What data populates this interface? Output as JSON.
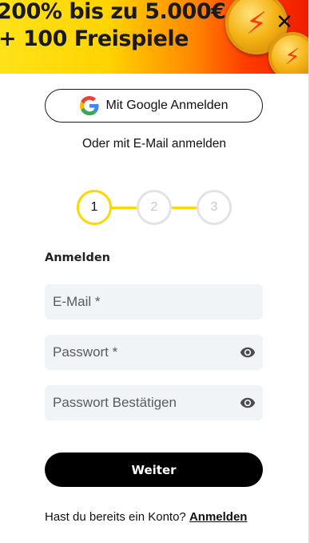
{
  "banner": {
    "line1": "200% bis zu 5.000€",
    "line2": "+ 100 Freispiele",
    "close_icon": "close-icon",
    "colors": {
      "gradient_start": "#ffe21a",
      "gradient_end": "#f01d00"
    }
  },
  "social": {
    "google_label": "Mit Google Anmelden",
    "google_icon": "google-logo-icon"
  },
  "or_text": "Oder mit E-Mail anmelden",
  "stepper": {
    "steps": [
      "1",
      "2",
      "3"
    ],
    "active_step": 1,
    "active_color": "#ffd600",
    "inactive_color": "#e3e3e3"
  },
  "form": {
    "title": "Anmelden",
    "email_placeholder": "E-Mail *",
    "password_placeholder": "Passwort *",
    "confirm_placeholder": "Passwort Bestätigen",
    "eye_icon": "eye-icon",
    "submit_label": "Weiter"
  },
  "footer": {
    "prompt": "Hast du bereits ein Konto?",
    "link_label": "Anmelden"
  }
}
